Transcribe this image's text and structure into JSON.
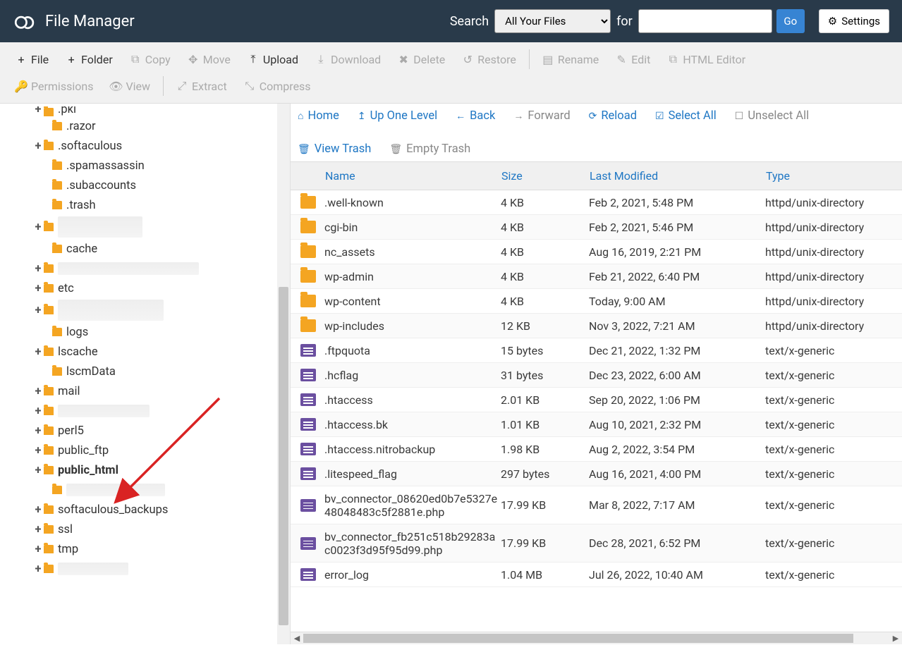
{
  "header": {
    "title": "File Manager",
    "search_label": "Search",
    "for_label": "for",
    "search_scope": "All Your Files",
    "search_value": "",
    "go": "Go",
    "settings": "Settings"
  },
  "toolbar": [
    {
      "id": "file",
      "label": "File",
      "enabled": true,
      "icon": "+"
    },
    {
      "id": "folder",
      "label": "Folder",
      "enabled": true,
      "icon": "+"
    },
    {
      "id": "copy",
      "label": "Copy",
      "enabled": false,
      "icon": "⧉"
    },
    {
      "id": "move",
      "label": "Move",
      "enabled": false,
      "icon": "✥"
    },
    {
      "id": "upload",
      "label": "Upload",
      "enabled": true,
      "icon": "⤒"
    },
    {
      "id": "download",
      "label": "Download",
      "enabled": false,
      "icon": "⤓"
    },
    {
      "id": "delete",
      "label": "Delete",
      "enabled": false,
      "icon": "✖"
    },
    {
      "id": "restore",
      "label": "Restore",
      "enabled": false,
      "icon": "↺"
    },
    {
      "id": "rename",
      "label": "Rename",
      "enabled": false,
      "icon": "▤"
    },
    {
      "id": "edit",
      "label": "Edit",
      "enabled": false,
      "icon": "✎"
    },
    {
      "id": "htmleditor",
      "label": "HTML Editor",
      "enabled": false,
      "icon": "⧉"
    },
    {
      "id": "perms",
      "label": "Permissions",
      "enabled": false,
      "icon": "🔑",
      "row": 2
    },
    {
      "id": "view",
      "label": "View",
      "enabled": false,
      "icon": "👁",
      "row": 2
    },
    {
      "id": "extract",
      "label": "Extract",
      "enabled": false,
      "icon": "⤢",
      "row": 2
    },
    {
      "id": "compress",
      "label": "Compress",
      "enabled": false,
      "icon": "⤡",
      "row": 2
    }
  ],
  "tree": [
    {
      "pm": "+",
      "label": ".pki",
      "indent": 38,
      "cut": true
    },
    {
      "pm": "",
      "label": ".razor",
      "indent": 50
    },
    {
      "pm": "+",
      "label": ".softaculous",
      "indent": 38
    },
    {
      "pm": "",
      "label": ".spamassassin",
      "indent": 50
    },
    {
      "pm": "",
      "label": ".subaccounts",
      "indent": 50
    },
    {
      "pm": "",
      "label": ".trash",
      "indent": 50
    },
    {
      "pm": "+",
      "label": "",
      "indent": 38,
      "masked": true,
      "mwidth": 120,
      "mheight": 34
    },
    {
      "pm": "",
      "label": "cache",
      "indent": 50
    },
    {
      "pm": "+",
      "label": "",
      "indent": 38,
      "masked": true,
      "mwidth": 200
    },
    {
      "pm": "+",
      "label": "etc",
      "indent": 38
    },
    {
      "pm": "+",
      "label": "",
      "indent": 38,
      "masked": true,
      "mwidth": 150,
      "mheight": 34
    },
    {
      "pm": "",
      "label": "logs",
      "indent": 50
    },
    {
      "pm": "+",
      "label": "lscache",
      "indent": 38
    },
    {
      "pm": "",
      "label": "lscmData",
      "indent": 50
    },
    {
      "pm": "+",
      "label": "mail",
      "indent": 38
    },
    {
      "pm": "+",
      "label": "",
      "indent": 38,
      "masked": true,
      "mwidth": 130
    },
    {
      "pm": "+",
      "label": "perl5",
      "indent": 38
    },
    {
      "pm": "+",
      "label": "public_ftp",
      "indent": 38
    },
    {
      "pm": "+",
      "label": "public_html",
      "indent": 38,
      "bold": true
    },
    {
      "pm": "",
      "label": "",
      "indent": 50,
      "masked": true,
      "mwidth": 140
    },
    {
      "pm": "+",
      "label": "softaculous_backups",
      "indent": 38
    },
    {
      "pm": "+",
      "label": "ssl",
      "indent": 38
    },
    {
      "pm": "+",
      "label": "tmp",
      "indent": 38
    },
    {
      "pm": "+",
      "label": "",
      "indent": 38,
      "masked": true,
      "mwidth": 100
    }
  ],
  "crumbs": [
    {
      "id": "home",
      "label": "Home",
      "icon": "⌂",
      "enabled": true
    },
    {
      "id": "up",
      "label": "Up One Level",
      "icon": "↥",
      "enabled": true
    },
    {
      "id": "back",
      "label": "Back",
      "icon": "←",
      "enabled": true
    },
    {
      "id": "forward",
      "label": "Forward",
      "icon": "→",
      "enabled": false
    },
    {
      "id": "reload",
      "label": "Reload",
      "icon": "⟳",
      "enabled": true
    },
    {
      "id": "selectall",
      "label": "Select All",
      "icon": "☑",
      "enabled": true
    },
    {
      "id": "unselect",
      "label": "Unselect All",
      "icon": "☐",
      "enabled": false
    },
    {
      "id": "viewtrash",
      "label": "View Trash",
      "icon": "🗑",
      "enabled": true,
      "row": 2
    },
    {
      "id": "emptytrash",
      "label": "Empty Trash",
      "icon": "🗑",
      "enabled": false,
      "row": 2
    }
  ],
  "columns": {
    "name": "Name",
    "size": "Size",
    "lm": "Last Modified",
    "type": "Type"
  },
  "files": [
    {
      "name": ".well-known",
      "size": "4 KB",
      "lm": "Feb 2, 2021, 5:48 PM",
      "type": "httpd/unix-directory",
      "kind": "folder"
    },
    {
      "name": "cgi-bin",
      "size": "4 KB",
      "lm": "Feb 2, 2021, 5:46 PM",
      "type": "httpd/unix-directory",
      "kind": "folder"
    },
    {
      "name": "nc_assets",
      "size": "4 KB",
      "lm": "Aug 16, 2019, 2:21 PM",
      "type": "httpd/unix-directory",
      "kind": "folder"
    },
    {
      "name": "wp-admin",
      "size": "4 KB",
      "lm": "Feb 21, 2022, 6:40 PM",
      "type": "httpd/unix-directory",
      "kind": "folder"
    },
    {
      "name": "wp-content",
      "size": "4 KB",
      "lm": "Today, 9:00 AM",
      "type": "httpd/unix-directory",
      "kind": "folder"
    },
    {
      "name": "wp-includes",
      "size": "12 KB",
      "lm": "Nov 3, 2022, 7:21 AM",
      "type": "httpd/unix-directory",
      "kind": "folder"
    },
    {
      "name": ".ftpquota",
      "size": "15 bytes",
      "lm": "Dec 21, 2022, 1:32 PM",
      "type": "text/x-generic",
      "kind": "file"
    },
    {
      "name": ".hcflag",
      "size": "31 bytes",
      "lm": "Dec 23, 2022, 6:00 AM",
      "type": "text/x-generic",
      "kind": "file"
    },
    {
      "name": ".htaccess",
      "size": "2.01 KB",
      "lm": "Sep 20, 2022, 1:06 PM",
      "type": "text/x-generic",
      "kind": "file"
    },
    {
      "name": ".htaccess.bk",
      "size": "1.01 KB",
      "lm": "Aug 10, 2021, 2:32 PM",
      "type": "text/x-generic",
      "kind": "file"
    },
    {
      "name": ".htaccess.nitrobackup",
      "size": "1.98 KB",
      "lm": "Aug 2, 2022, 3:54 PM",
      "type": "text/x-generic",
      "kind": "file"
    },
    {
      "name": ".litespeed_flag",
      "size": "297 bytes",
      "lm": "Aug 16, 2021, 4:00 PM",
      "type": "text/x-generic",
      "kind": "file"
    },
    {
      "name": "bv_connector_08620ed0b7e5327e48048483c5f2881e.php",
      "size": "17.99 KB",
      "lm": "Mar 8, 2022, 7:17 AM",
      "type": "text/x-generic",
      "kind": "file"
    },
    {
      "name": "bv_connector_fb251c518b29283ac0023f3d95f95d99.php",
      "size": "17.99 KB",
      "lm": "Dec 28, 2021, 6:52 PM",
      "type": "text/x-generic",
      "kind": "file"
    },
    {
      "name": "error_log",
      "size": "1.04 MB",
      "lm": "Jul 26, 2022, 10:40 AM",
      "type": "text/x-generic",
      "kind": "file"
    }
  ]
}
